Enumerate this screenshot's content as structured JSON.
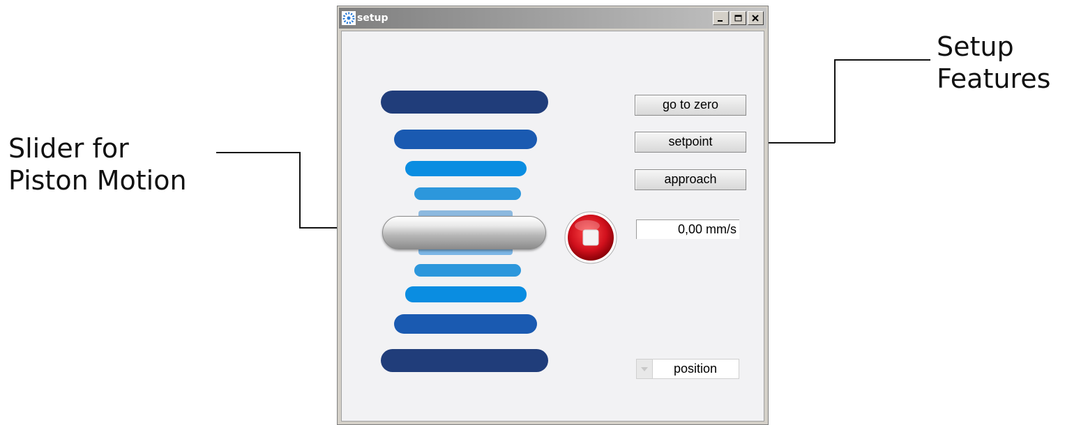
{
  "window": {
    "title": "setup",
    "controls": [
      "minimize-icon",
      "maximize-icon",
      "close-icon"
    ]
  },
  "annotations": {
    "left": {
      "line1": "Slider for",
      "line2": "Piston Motion"
    },
    "right": {
      "line1": "Setup",
      "line2": "Features"
    }
  },
  "controls": {
    "go_to_zero": "go to zero",
    "setpoint": "setpoint",
    "approach": "approach",
    "speed": "0,00 mm/s",
    "mode_select": "position"
  },
  "piston_bars": {
    "colors": [
      "#203d7a",
      "#1a5ab1",
      "#0a8de1",
      "#2c97dc",
      "#8cb9df",
      "#7cb6e6",
      "#2c97dc",
      "#0a8de1",
      "#1a5ab1",
      "#203d7a"
    ]
  },
  "icons": {
    "stop": "stop-icon",
    "app": "app-icon"
  },
  "colors": {
    "stop_red": "#d0101c",
    "titlebar_start": "#7f7f7f",
    "titlebar_end": "#c4c4c4"
  }
}
